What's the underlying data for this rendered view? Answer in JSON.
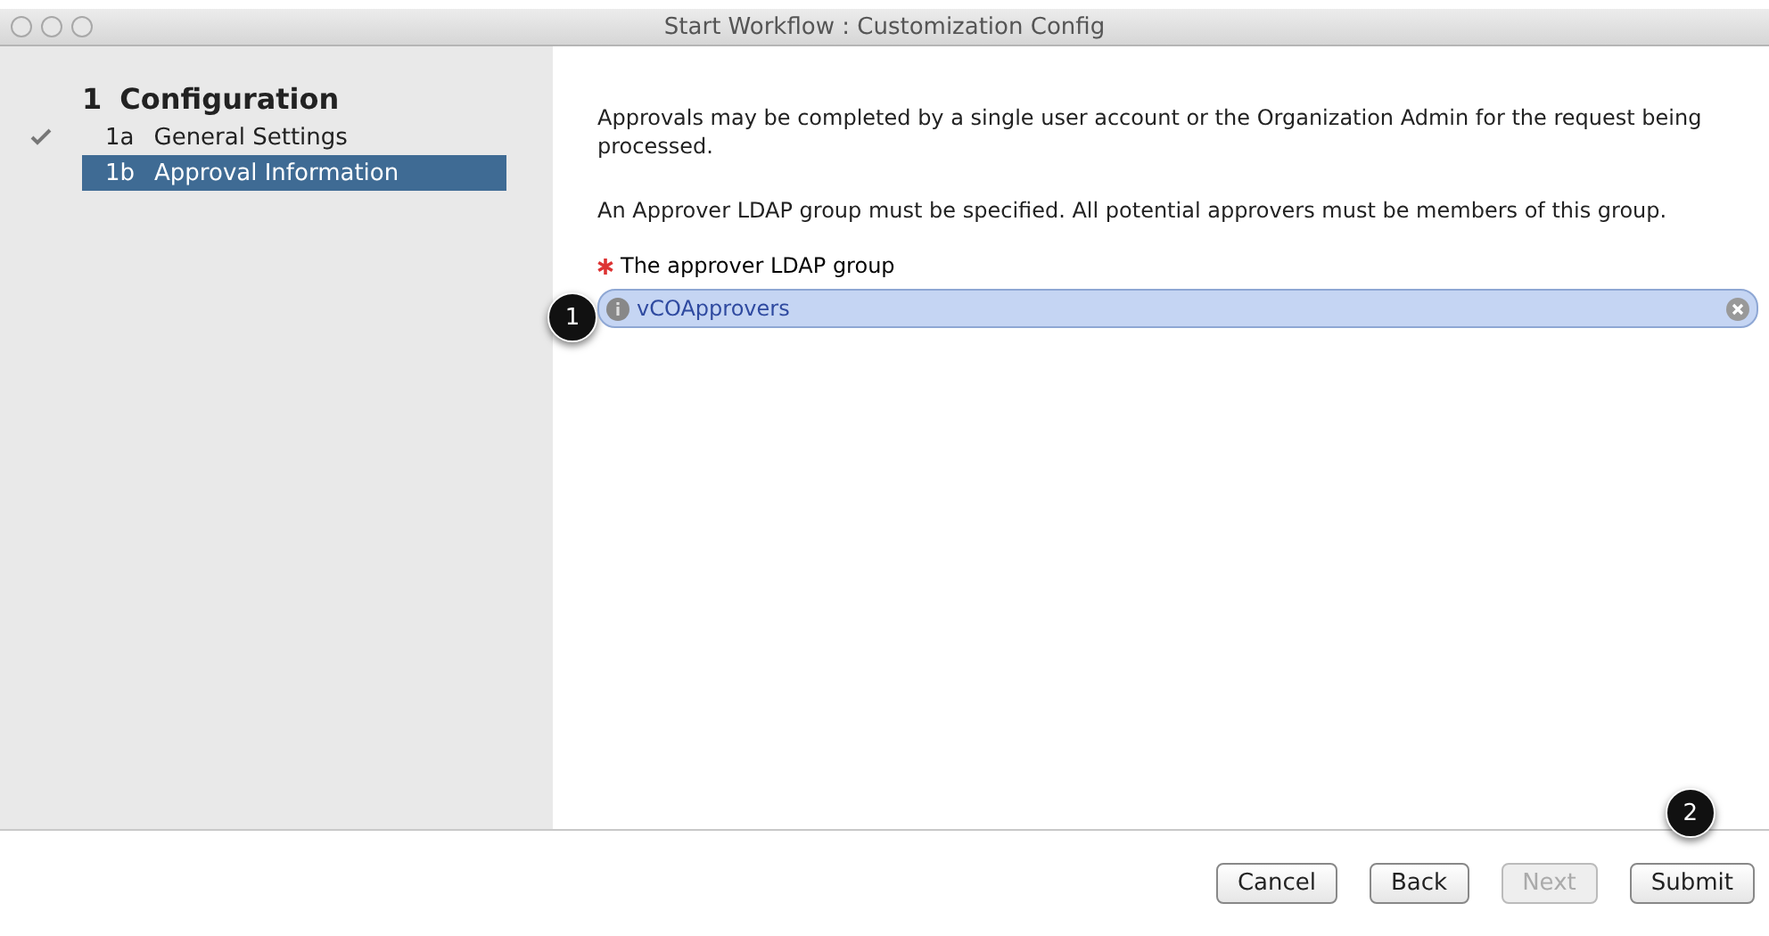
{
  "window": {
    "title": "Start Workflow : Customization Config"
  },
  "sidebar": {
    "section": {
      "number": "1",
      "label": "Configuration"
    },
    "items": [
      {
        "number": "1a",
        "label": "General Settings",
        "done": true,
        "selected": false
      },
      {
        "number": "1b",
        "label": "Approval Information",
        "done": false,
        "selected": true
      }
    ]
  },
  "content": {
    "paragraphs": [
      "Approvals may be completed by a single user account or the Organization Admin for the request being processed.",
      "An Approver LDAP group must be specified. All potential approvers must be members of this group."
    ],
    "field": {
      "label": "The approver LDAP group",
      "required": true,
      "value": "vCOApprovers",
      "callout": "1"
    }
  },
  "buttons": [
    {
      "label": "Cancel",
      "disabled": false
    },
    {
      "label": "Back",
      "disabled": false
    },
    {
      "label": "Next",
      "disabled": true
    },
    {
      "label": "Submit",
      "disabled": false,
      "callout": "2"
    }
  ]
}
